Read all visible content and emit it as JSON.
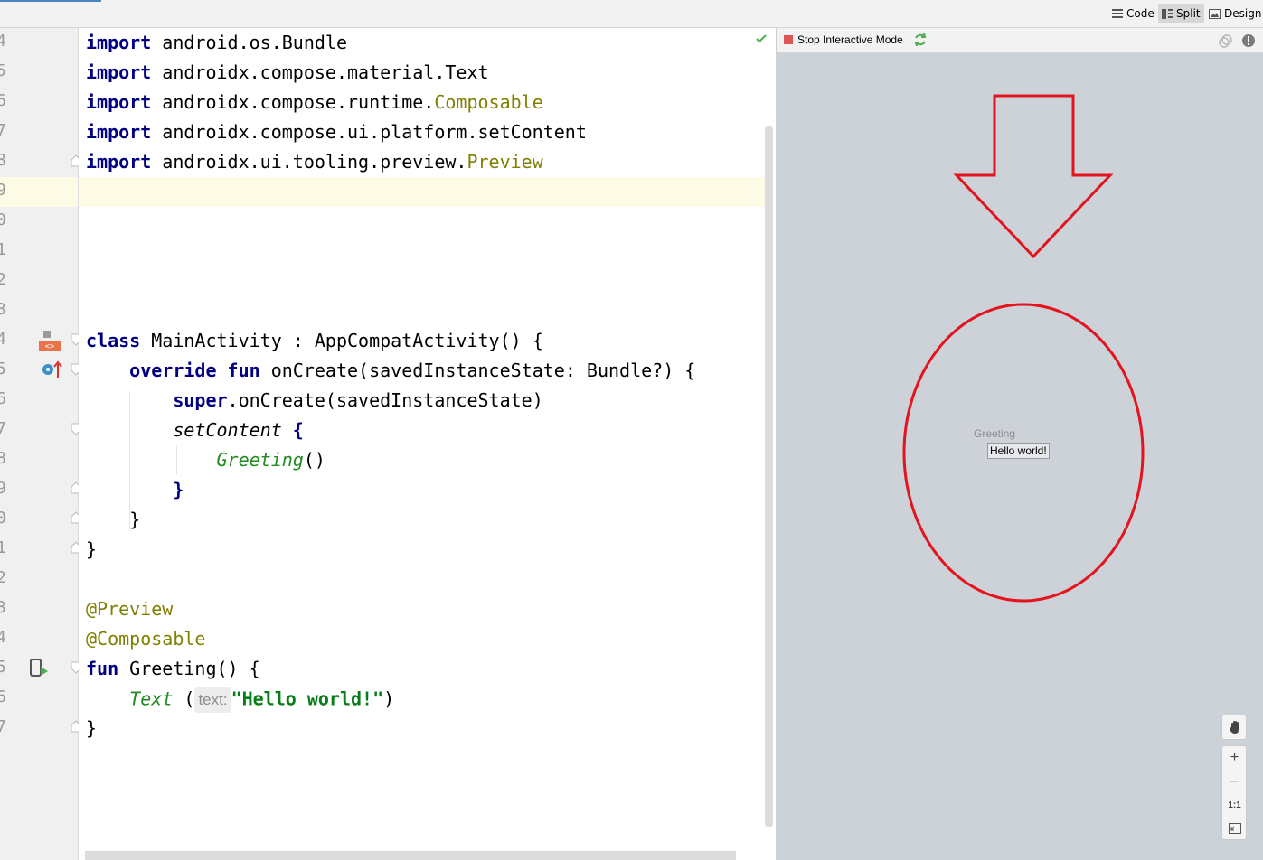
{
  "toolbar": {
    "modes": [
      {
        "label": "Code",
        "icon": "code-lines-icon",
        "selected": false
      },
      {
        "label": "Split",
        "icon": "split-view-icon",
        "selected": true
      },
      {
        "label": "Design",
        "icon": "image-icon",
        "selected": false
      }
    ]
  },
  "gutter": {
    "line_numbers": [
      "4",
      "5",
      "6",
      "7",
      "8",
      "9",
      "0",
      "1",
      "2",
      "3",
      "4",
      "5",
      "6",
      "7",
      "8",
      "9",
      "0",
      "1",
      "2",
      "3",
      "4",
      "5",
      "6",
      "7"
    ]
  },
  "editor": {
    "current_line_index": 5,
    "lines": [
      {
        "segments": [
          {
            "t": "import",
            "c": "kw"
          },
          {
            "t": " android.os.Bundle",
            "c": ""
          }
        ]
      },
      {
        "segments": [
          {
            "t": "import",
            "c": "kw"
          },
          {
            "t": " androidx.compose.material.Text",
            "c": ""
          }
        ]
      },
      {
        "segments": [
          {
            "t": "import",
            "c": "kw"
          },
          {
            "t": " androidx.compose.runtime.",
            "c": ""
          },
          {
            "t": "Composable",
            "c": "ann"
          }
        ]
      },
      {
        "segments": [
          {
            "t": "import",
            "c": "kw"
          },
          {
            "t": " androidx.compose.ui.platform.setContent",
            "c": ""
          }
        ]
      },
      {
        "segments": [
          {
            "t": "import",
            "c": "kw"
          },
          {
            "t": " androidx.ui.tooling.preview.",
            "c": ""
          },
          {
            "t": "Preview",
            "c": "ann"
          }
        ]
      },
      {
        "segments": []
      },
      {
        "segments": []
      },
      {
        "segments": []
      },
      {
        "segments": []
      },
      {
        "segments": []
      },
      {
        "segments": [
          {
            "t": "class",
            "c": "kw"
          },
          {
            "t": " MainActivity : AppCompatActivity() {",
            "c": ""
          }
        ]
      },
      {
        "segments": [
          {
            "t": "    ",
            "c": ""
          },
          {
            "t": "override fun",
            "c": "kw"
          },
          {
            "t": " onCreate(savedInstanceState: Bundle?) {",
            "c": ""
          }
        ]
      },
      {
        "segments": [
          {
            "t": "        ",
            "c": ""
          },
          {
            "t": "super",
            "c": "kw"
          },
          {
            "t": ".onCreate(savedInstanceState)",
            "c": ""
          }
        ]
      },
      {
        "segments": [
          {
            "t": "        ",
            "c": ""
          },
          {
            "t": "setContent",
            "c": "call-it"
          },
          {
            "t": " ",
            "c": ""
          },
          {
            "t": "{",
            "c": "kw"
          }
        ]
      },
      {
        "segments": [
          {
            "t": "            ",
            "c": ""
          },
          {
            "t": "Greeting",
            "c": "green-it"
          },
          {
            "t": "()",
            "c": ""
          }
        ]
      },
      {
        "segments": [
          {
            "t": "        ",
            "c": ""
          },
          {
            "t": "}",
            "c": "kw"
          }
        ]
      },
      {
        "segments": [
          {
            "t": "    }",
            "c": ""
          }
        ]
      },
      {
        "segments": [
          {
            "t": "}",
            "c": ""
          }
        ]
      },
      {
        "segments": []
      },
      {
        "segments": [
          {
            "t": "@Preview",
            "c": "ann"
          }
        ]
      },
      {
        "segments": [
          {
            "t": "@Composable",
            "c": "ann"
          }
        ]
      },
      {
        "segments": [
          {
            "t": "fun",
            "c": "kw"
          },
          {
            "t": " Greeting() {",
            "c": ""
          }
        ]
      },
      {
        "segments": [
          {
            "t": "    ",
            "c": ""
          },
          {
            "t": "Text",
            "c": "green-it"
          },
          {
            "t": " (",
            "c": ""
          },
          {
            "t": "text:",
            "c": "hint"
          },
          {
            "t": "\"Hello world!\"",
            "c": "str"
          },
          {
            "t": ")",
            "c": ""
          }
        ]
      },
      {
        "segments": [
          {
            "t": "}",
            "c": ""
          }
        ]
      }
    ]
  },
  "preview": {
    "stop_label": "Stop Interactive Mode",
    "component_label": "Greeting",
    "rendered_text": "Hello world!"
  },
  "zoom": {
    "items": [
      {
        "name": "pan-hand-icon",
        "label": ""
      },
      {
        "name": "zoom-in-button",
        "label": "+"
      },
      {
        "name": "zoom-out-button",
        "label": "–"
      },
      {
        "name": "zoom-actual-size-button",
        "label": "1:1"
      },
      {
        "name": "zoom-to-fit-icon",
        "label": ""
      }
    ]
  },
  "colors": {
    "keyword": "#000080",
    "annotation": "#808000",
    "string": "#067d17",
    "function_call": "#218b21",
    "overlay_red": "#e3141e",
    "preview_bg": "#cdd1d8"
  }
}
